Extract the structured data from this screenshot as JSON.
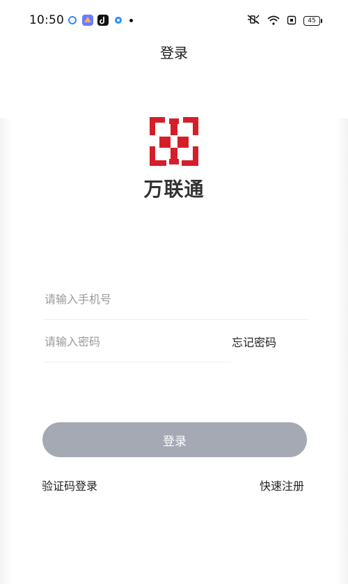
{
  "status_bar": {
    "time": "10:50",
    "battery": "45"
  },
  "header": {
    "title": "登录"
  },
  "logo": {
    "brand": "万联通"
  },
  "form": {
    "phone": {
      "placeholder": "请输入手机号",
      "value": ""
    },
    "password": {
      "placeholder": "请输入密码",
      "value": ""
    },
    "forgot_label": "忘记密码",
    "login_label": "登录",
    "sms_login_label": "验证码登录",
    "register_label": "快速注册"
  },
  "colors": {
    "brand_red": "#d51e2a",
    "button_gray": "#a5a9b3"
  },
  "icons": [
    "status-app-icon",
    "mute-icon",
    "wifi-icon",
    "sim-icon",
    "battery-icon",
    "brand-logo-icon"
  ]
}
